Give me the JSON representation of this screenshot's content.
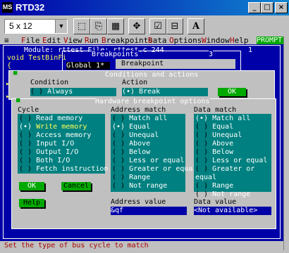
{
  "window": {
    "title": "RTD32",
    "app_icon": "MS",
    "min": "_",
    "max": "□",
    "close": "×"
  },
  "toolbar": {
    "font_size": "5 x 12",
    "font_arrow": "▼",
    "buttons": [
      "⬚",
      "⎘",
      "▦",
      "✥",
      "☑",
      "⊟",
      "A"
    ]
  },
  "menu": {
    "sys": "≡",
    "items": [
      {
        "first": "F",
        "rest": "ile"
      },
      {
        "first": "E",
        "rest": "dit"
      },
      {
        "first": "V",
        "rest": "iew"
      },
      {
        "first": "R",
        "rest": "un"
      },
      {
        "first": "B",
        "rest": "reakpoints"
      },
      {
        "first": "D",
        "rest": "ata"
      },
      {
        "first": "O",
        "rest": "ptions"
      },
      {
        "first": "W",
        "rest": "indow"
      },
      {
        "first": "H",
        "rest": "elp"
      }
    ],
    "prompt": "PROMPT"
  },
  "background": {
    "module_title": "Module: rttest File: rttest.c 244",
    "module_num": "1",
    "code_line1": "void TestBinFi",
    "code_line2": "{",
    "bp_window_title": "Breakpoints",
    "bp_window_num": "3",
    "bp_list_item": "Global 1*",
    "bp_label": "Breakpoint"
  },
  "dialog": {
    "title": "Conditions and actions",
    "condition_label": "Condition",
    "condition_value": "Always",
    "action_label": "Action",
    "action_value": "Break",
    "ok_top": "OK",
    "hw_title": "Hardware breakpoint options",
    "cycle_header": "Cycle",
    "cycle": [
      {
        "mark": "( )",
        "label": "Read memory"
      },
      {
        "mark": "(•)",
        "label": "Write memory"
      },
      {
        "mark": "( )",
        "label": "Access memory"
      },
      {
        "mark": "( )",
        "label": "Input I/O"
      },
      {
        "mark": "( )",
        "label": "Output I/O"
      },
      {
        "mark": "( )",
        "label": "Both I/O"
      },
      {
        "mark": "( )",
        "label": "Fetch instruction"
      }
    ],
    "addr_header": "Address match",
    "addr_match": [
      {
        "mark": "( )",
        "label": "Match all"
      },
      {
        "mark": "(•)",
        "label": "Equal"
      },
      {
        "mark": "( )",
        "label": "Unequal"
      },
      {
        "mark": "( )",
        "label": "Above"
      },
      {
        "mark": "( )",
        "label": "Below"
      },
      {
        "mark": "( )",
        "label": "Less or equal"
      },
      {
        "mark": "( )",
        "label": "Greater or equal"
      },
      {
        "mark": "( )",
        "label": "Range"
      },
      {
        "mark": "( )",
        "label": "Not range"
      }
    ],
    "data_header": "Data match",
    "data_match": [
      {
        "mark": "(•)",
        "label": "Match all"
      },
      {
        "mark": "( )",
        "label": "Equal"
      },
      {
        "mark": "( )",
        "label": "Unequal"
      },
      {
        "mark": "( )",
        "label": "Above"
      },
      {
        "mark": "( )",
        "label": "Below"
      },
      {
        "mark": "( )",
        "label": "Less or equal"
      },
      {
        "mark": "( )",
        "label": "Greater or equal"
      },
      {
        "mark": "( )",
        "label": "Range"
      },
      {
        "mark": "( )",
        "label": "Not range"
      }
    ],
    "ok": "OK",
    "cancel": "Cancel",
    "help": "Help",
    "addr_value_label": "Address value",
    "addr_value": "&qf",
    "data_value_label": "Data value",
    "data_value": "<Not available>"
  },
  "status": "Set the type of bus cycle to match",
  "colors": {
    "dos_blue": "#0000a8",
    "cyan": "#008080",
    "green": "#00a800",
    "gray": "#c0c0c0",
    "red": "#a80000"
  }
}
